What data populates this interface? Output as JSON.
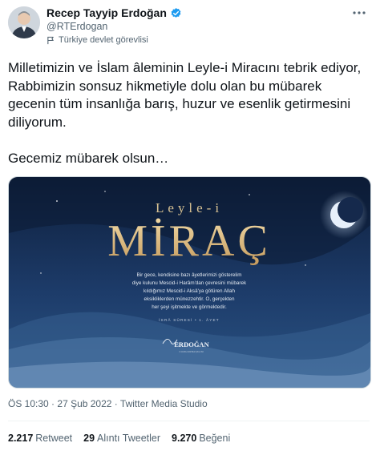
{
  "author": {
    "name": "Recep Tayyip Erdoğan",
    "handle": "@RTErdogan",
    "affiliation": "Türkiye devlet görevlisi",
    "avatar_icon": "portrait-avatar",
    "verified_color": "#1d9bf0"
  },
  "tweet": {
    "text": "Milletimizin ve İslam âleminin Leyle-i Miracını tebrik ediyor, Rabbimizin sonsuz hikmetiyle dolu olan bu mübarek gecenin tüm insanlığa barış, huzur ve esenlik getirmesini diliyorum.\n\nGecemiz mübarek olsun…"
  },
  "media": {
    "subtitle": "Leyle-i",
    "title": "MİRAÇ",
    "verse_lines": [
      "Bir gece, kendisine bazı âyetlerimizi gösterelim",
      "diye kulunu Mescid-i Harâm'dan çevresini mübarek",
      "kıldığımız Mescid-i Aksâ'ya götüren Allah",
      "eksikliklerden münezzehtir. O, gerçekten",
      "her şeyi işitmekte ve görmektedir."
    ],
    "verse_source": "İSRÂ SÛRESİ • 1. ÂYET",
    "signature_name": "ERDOĞAN",
    "signature_caption": "CUMHURBAŞKANI"
  },
  "meta": {
    "time": "ÖS 10:30",
    "date": "27 Şub 2022",
    "separator": "·",
    "source": "Twitter Media Studio"
  },
  "stats": {
    "retweets_count": "2.217",
    "retweets_label": "Retweet",
    "quotes_count": "29",
    "quotes_label": "Alıntı Tweetler",
    "likes_count": "9.270",
    "likes_label": "Beğeni"
  }
}
